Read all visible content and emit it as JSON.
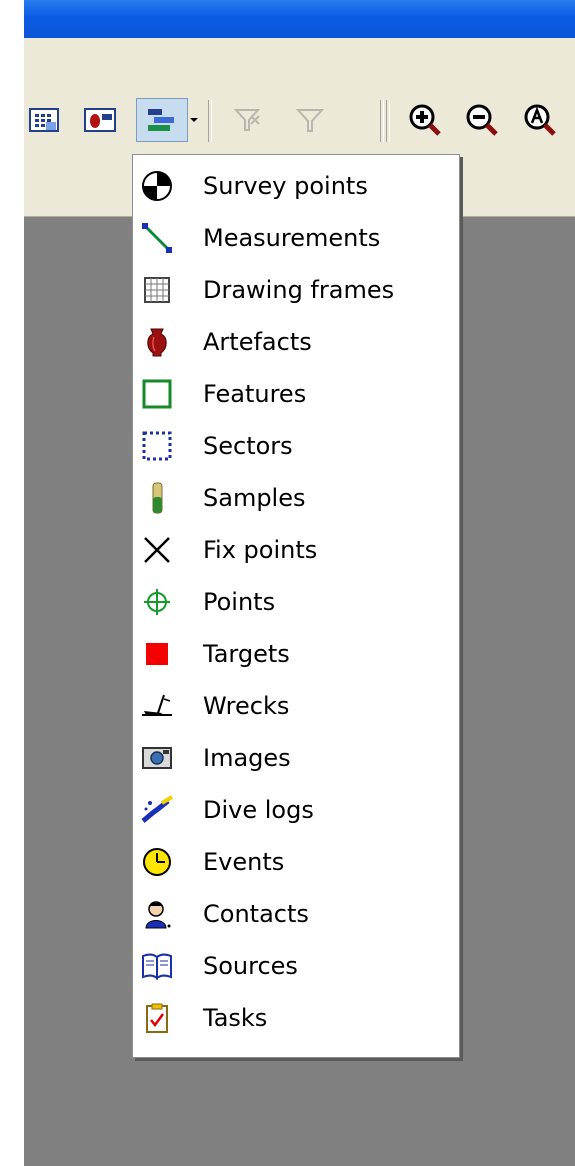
{
  "menu": {
    "items": [
      {
        "label": "Survey points",
        "icon": "survey-points-icon"
      },
      {
        "label": "Measurements",
        "icon": "measurements-icon"
      },
      {
        "label": "Drawing frames",
        "icon": "drawing-frames-icon"
      },
      {
        "label": "Artefacts",
        "icon": "artefacts-icon"
      },
      {
        "label": "Features",
        "icon": "features-icon"
      },
      {
        "label": "Sectors",
        "icon": "sectors-icon"
      },
      {
        "label": "Samples",
        "icon": "samples-icon"
      },
      {
        "label": "Fix points",
        "icon": "fix-points-icon"
      },
      {
        "label": "Points",
        "icon": "points-icon"
      },
      {
        "label": "Targets",
        "icon": "targets-icon"
      },
      {
        "label": "Wrecks",
        "icon": "wrecks-icon"
      },
      {
        "label": "Images",
        "icon": "images-icon"
      },
      {
        "label": "Dive logs",
        "icon": "dive-logs-icon"
      },
      {
        "label": "Events",
        "icon": "events-icon"
      },
      {
        "label": "Contacts",
        "icon": "contacts-icon"
      },
      {
        "label": "Sources",
        "icon": "sources-icon"
      },
      {
        "label": "Tasks",
        "icon": "tasks-icon"
      }
    ]
  },
  "colors": {
    "title_bar": "#0a5be3",
    "chrome": "#ece9d8",
    "workspace": "#808080",
    "menu_background": "#ffffff"
  }
}
